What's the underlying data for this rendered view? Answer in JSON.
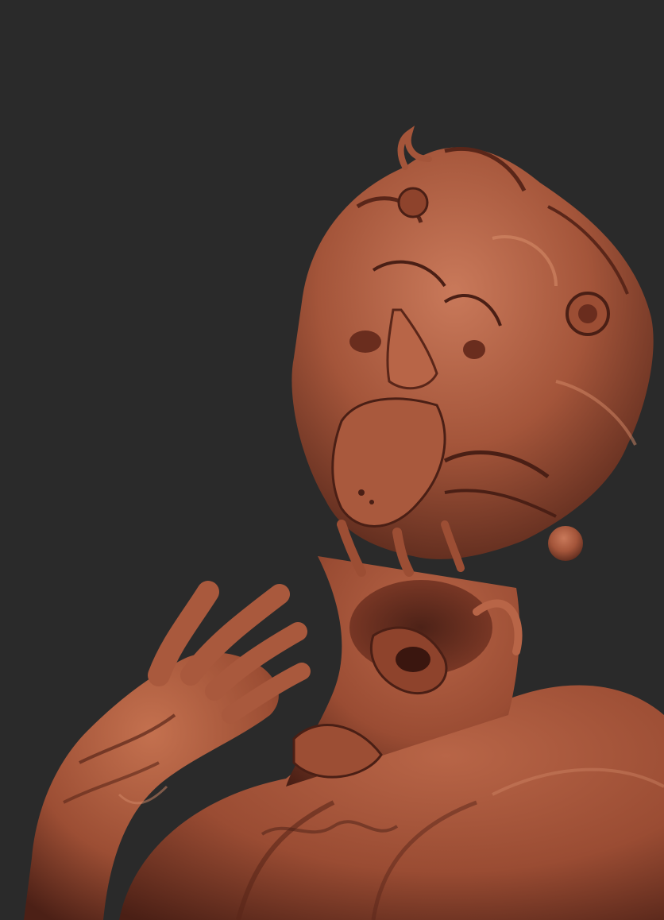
{
  "scene": {
    "background_color": "#2a2a2a",
    "clay_base_color": "#a4553a",
    "clay_highlight_color": "#c9795a",
    "clay_shadow_color": "#4e2217"
  },
  "subjects": [
    {
      "id": "creature-head",
      "kind": "sculpted grotesque head with swirling hair"
    },
    {
      "id": "creature-hand",
      "kind": "sculpted raised hand with long fingers"
    },
    {
      "id": "creature-torso",
      "kind": "sculpted shoulders and chest"
    }
  ]
}
